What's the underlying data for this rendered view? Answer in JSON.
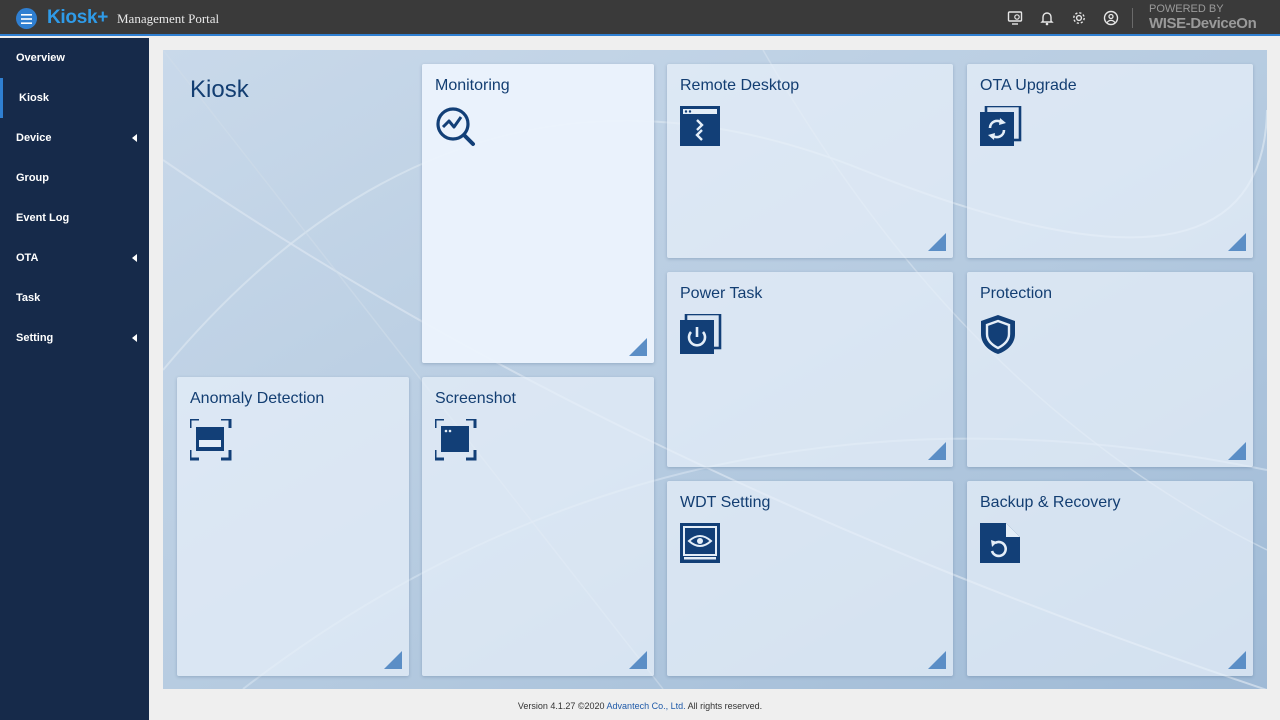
{
  "header": {
    "brand": "Kiosk+",
    "title": "Management Portal",
    "powered_by": "POWERED BY",
    "product": "WISE-DeviceOn",
    "icons": [
      "menu-icon",
      "monitor-settings-icon",
      "bell-icon",
      "gear-icon",
      "user-icon"
    ]
  },
  "sidebar": {
    "items": [
      {
        "label": "Overview",
        "expandable": false,
        "active": false
      },
      {
        "label": "Kiosk",
        "expandable": false,
        "active": true
      },
      {
        "label": "Device",
        "expandable": true,
        "active": false
      },
      {
        "label": "Group",
        "expandable": false,
        "active": false
      },
      {
        "label": "Event Log",
        "expandable": false,
        "active": false
      },
      {
        "label": "OTA",
        "expandable": true,
        "active": false
      },
      {
        "label": "Task",
        "expandable": false,
        "active": false
      },
      {
        "label": "Setting",
        "expandable": true,
        "active": false
      }
    ]
  },
  "main": {
    "title": "Kiosk",
    "tiles": [
      {
        "label": "Monitoring",
        "icon": "monitoring-chart-magnifier-icon",
        "highlighted": true
      },
      {
        "label": "Remote Desktop",
        "icon": "remote-desktop-icon",
        "highlighted": false
      },
      {
        "label": "OTA Upgrade",
        "icon": "ota-upgrade-refresh-icon",
        "highlighted": false
      },
      {
        "label": "Power Task",
        "icon": "power-icon",
        "highlighted": false
      },
      {
        "label": "Protection",
        "icon": "shield-icon",
        "highlighted": false
      },
      {
        "label": "Anomaly Detection",
        "icon": "anomaly-scan-icon",
        "highlighted": false
      },
      {
        "label": "Screenshot",
        "icon": "screenshot-icon",
        "highlighted": false
      },
      {
        "label": "WDT Setting",
        "icon": "wdt-eye-icon",
        "highlighted": false
      },
      {
        "label": "Backup & Recovery",
        "icon": "backup-recovery-icon",
        "highlighted": false
      }
    ]
  },
  "footer": {
    "prefix": "Version 4.1.27 ©2020 ",
    "company": "Advantech Co., Ltd.",
    "suffix": " All rights reserved."
  },
  "colors": {
    "topbar": "#3a3a3a",
    "accent": "#2f7fd1",
    "sidebar": "#162a4a",
    "tile_text": "#133e72",
    "panel": "#b5cbe0"
  }
}
